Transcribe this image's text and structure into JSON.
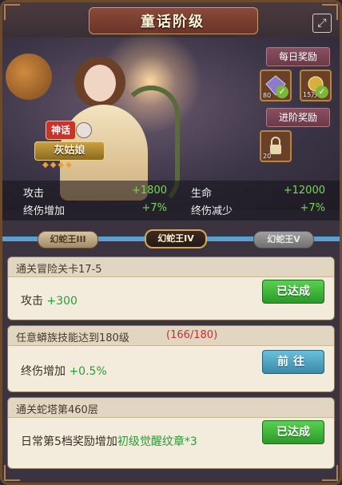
{
  "header": {
    "title": "童话阶级",
    "close_icon": "close-icon"
  },
  "hero": {
    "rarity_badge": "神话",
    "name": "灰姑娘",
    "stars": "◆◆◆◆"
  },
  "rewards": {
    "daily_label": "每日奖励",
    "daily_items": [
      {
        "icon": "diamond-icon",
        "count": "80"
      },
      {
        "icon": "resource-icon",
        "count": "15万"
      }
    ],
    "advance_label": "进阶奖励",
    "advance_items": [
      {
        "icon": "locked-chest-icon",
        "count": "20"
      }
    ]
  },
  "stats": {
    "attack_label": "攻击",
    "attack_value": "+1800",
    "hp_label": "生命",
    "hp_value": "+12000",
    "final_dmg_inc_label": "终伤增加",
    "final_dmg_inc_value": "+7%",
    "final_dmg_red_label": "终伤减少",
    "final_dmg_red_value": "+7%"
  },
  "stages": [
    {
      "label": "幻蛇王III",
      "state": "done"
    },
    {
      "label": "幻蛇王IV",
      "state": "active"
    },
    {
      "label": "幻蛇王V",
      "state": "locked"
    }
  ],
  "conditions": [
    {
      "title": "通关冒险关卡17-5",
      "progress": "",
      "reward_prefix": "攻击",
      "reward_value": "+300",
      "reward_suffix": "",
      "button": "已达成"
    },
    {
      "title": "任意蟒族技能达到180级",
      "progress": "(166/180)",
      "reward_prefix": "终伤增加",
      "reward_value": "+0.5%",
      "reward_suffix": "",
      "button": "前往"
    },
    {
      "title": "通关蛇塔第460层",
      "progress": "",
      "reward_prefix": "日常第5档奖励增加",
      "reward_value": "初级觉醒纹章",
      "reward_suffix": "*3",
      "button": "已达成"
    }
  ],
  "colors": {
    "positive": "#7ad85a",
    "progress_red": "#c83030",
    "done_button": "#3ab83a",
    "go_button": "#4a9ab8"
  }
}
